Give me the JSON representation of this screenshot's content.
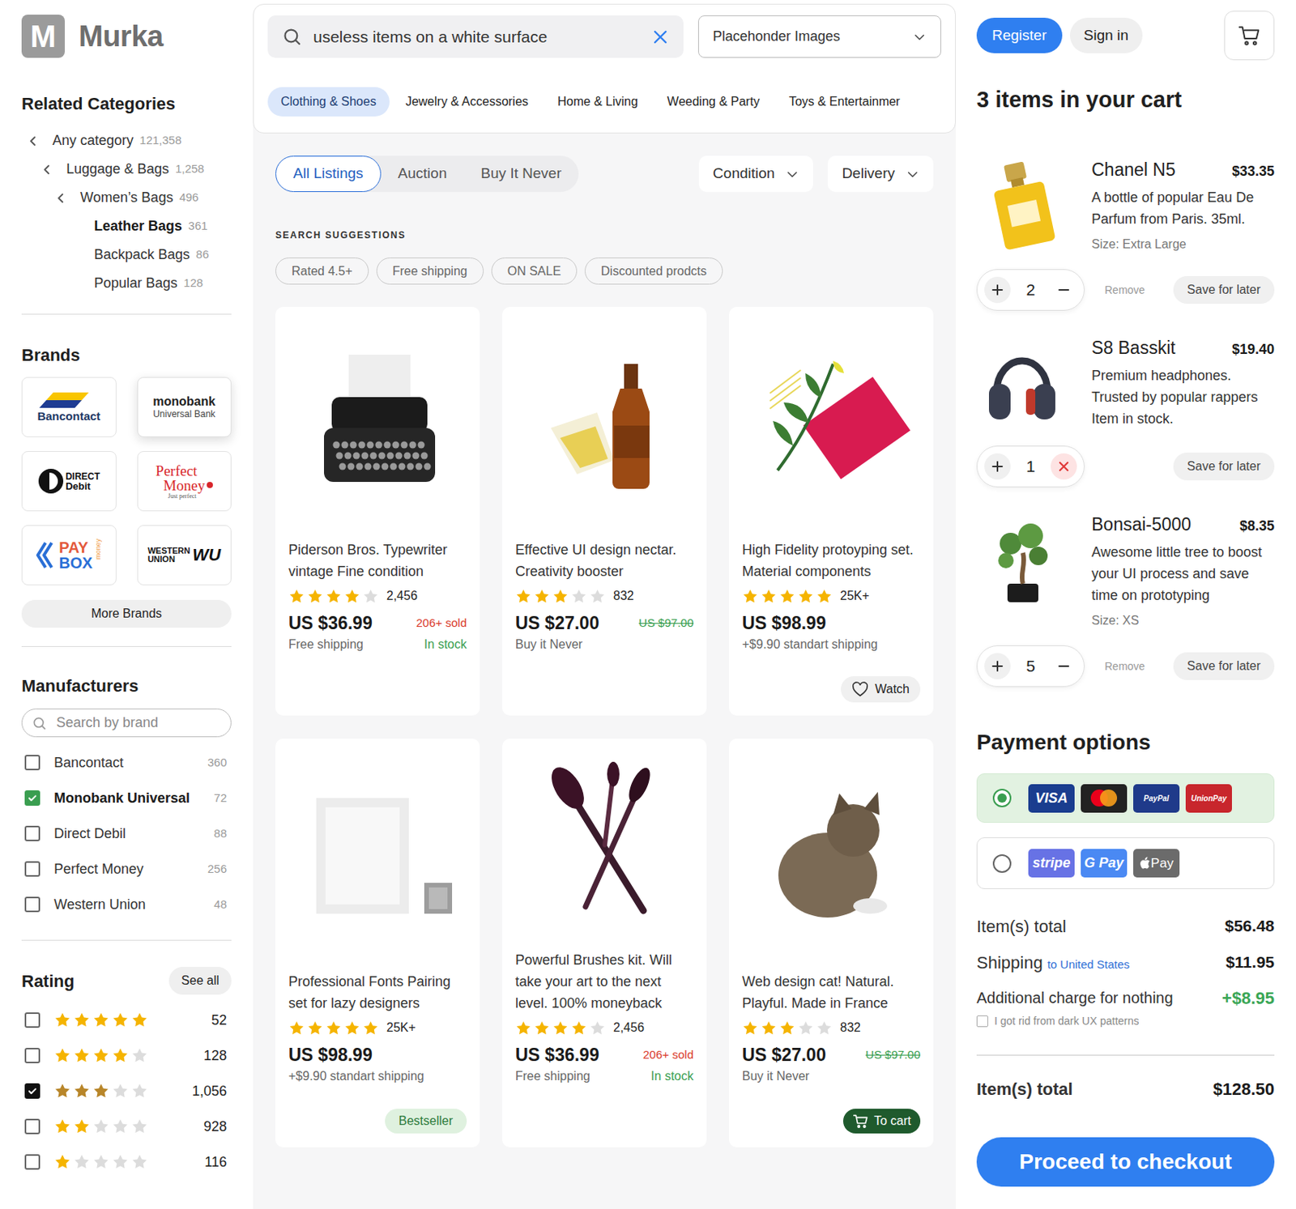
{
  "brand": {
    "mark": "M",
    "name": "Murka"
  },
  "search": {
    "value": "useless items on a white surface"
  },
  "image_source": {
    "label": "Placehonder Images"
  },
  "auth": {
    "register": "Register",
    "sign_in": "Sign in"
  },
  "category_tabs": [
    {
      "label": "Clothing & Shoes",
      "selected": true
    },
    {
      "label": "Jewelry & Accessories",
      "selected": false
    },
    {
      "label": "Home & Living",
      "selected": false
    },
    {
      "label": "Weeding & Party",
      "selected": false
    },
    {
      "label": "Toys & Entertainmer",
      "selected": false
    }
  ],
  "related": {
    "title": "Related Categories",
    "items": [
      {
        "label": "Any category",
        "count": "121,358",
        "depth": 0,
        "kind": "parent",
        "selected": false
      },
      {
        "label": "Luggage & Bags",
        "count": "1,258",
        "depth": 1,
        "kind": "parent",
        "selected": false
      },
      {
        "label": "Women’s Bags",
        "count": "496",
        "depth": 2,
        "kind": "parent",
        "selected": false
      },
      {
        "label": "Leather Bags",
        "count": "361",
        "depth": 3,
        "kind": "child",
        "selected": true
      },
      {
        "label": "Backpack Bags",
        "count": "86",
        "depth": 3,
        "kind": "child",
        "selected": false
      },
      {
        "label": "Popular Bags",
        "count": "128",
        "depth": 3,
        "kind": "child",
        "selected": false
      }
    ]
  },
  "brands": {
    "title": "Brands",
    "more": "More Brands",
    "tiles": [
      {
        "kind": "bancontact",
        "lines": [
          "Bancontact"
        ],
        "selected": false
      },
      {
        "kind": "stack",
        "lines": [
          "monobank",
          "Universal Bank"
        ],
        "selected": true
      },
      {
        "kind": "direct",
        "lines": [
          "DIRECT",
          "Debit"
        ],
        "selected": false
      },
      {
        "kind": "perfect",
        "lines": [
          "Perfect",
          "Money",
          "Just perfect"
        ],
        "selected": false
      },
      {
        "kind": "paybox",
        "lines": [
          "PAY",
          "BOX",
          "money"
        ],
        "selected": false
      },
      {
        "kind": "wu",
        "lines": [
          "WESTERN",
          "UNION",
          "WU"
        ],
        "selected": false
      }
    ]
  },
  "manufacturers": {
    "title": "Manufacturers",
    "placeholder": "Search by brand",
    "items": [
      {
        "label": "Bancontact",
        "count": "360",
        "checked": false
      },
      {
        "label": "Monobank Universal",
        "count": "72",
        "checked": true
      },
      {
        "label": "Direct Debil",
        "count": "88",
        "checked": false
      },
      {
        "label": "Perfect Money",
        "count": "256",
        "checked": false
      },
      {
        "label": "Western Union",
        "count": "48",
        "checked": false
      }
    ]
  },
  "rating": {
    "title": "Rating",
    "see_all": "See all",
    "rows": [
      {
        "stars": 5,
        "count": "52",
        "checked": false
      },
      {
        "stars": 4,
        "count": "128",
        "checked": false
      },
      {
        "stars": 3,
        "count": "1,056",
        "checked": true
      },
      {
        "stars": 2,
        "count": "928",
        "checked": false
      },
      {
        "stars": 1,
        "count": "116",
        "checked": false
      }
    ]
  },
  "listing_tabs": [
    {
      "label": "All Listings",
      "selected": true
    },
    {
      "label": "Auction",
      "selected": false
    },
    {
      "label": "Buy It Never",
      "selected": false
    }
  ],
  "filters": [
    {
      "label": "Condition"
    },
    {
      "label": "Delivery"
    }
  ],
  "suggestions": {
    "title": "SEARCH SUGGESTIONS",
    "chips": [
      "Rated 4.5+",
      "Free shipping",
      "ON SALE",
      "Discounted prodcts"
    ]
  },
  "products": [
    {
      "title": "Piderson Bros. Typewriter vintage Fine condition",
      "stars": 4,
      "reviews": "2,456",
      "price": "US $36.99",
      "tag": {
        "kind": "sold",
        "label": "206+ sold"
      },
      "shipping": "Free shipping",
      "stock": "In stock"
    },
    {
      "title": "Effective UI design nectar. Creativity booster",
      "stars": 3,
      "reviews": "832",
      "price": "US $27.00",
      "tag": {
        "kind": "old_price",
        "label": "US $97.00"
      },
      "shipping": "Buy it Never"
    },
    {
      "title": "High Fidelity protoyping set. Material components",
      "stars": 5,
      "reviews": "25K+",
      "price": "US $98.99",
      "shipping": "+$9.90 standart shipping",
      "action": {
        "kind": "watch",
        "label": "Watch"
      }
    },
    {
      "title": "Professional Fonts Pairing set for lazy designers",
      "stars": 5,
      "reviews": "25K+",
      "price": "US $98.99",
      "shipping": "+$9.90 standart shipping",
      "action": {
        "kind": "badge",
        "label": "Bestseller"
      }
    },
    {
      "title": "Powerful Brushes kit. Will take your art to the next level. 100% moneyback",
      "stars": 4,
      "reviews": "2,456",
      "price": "US $36.99",
      "tag": {
        "kind": "sold",
        "label": "206+ sold"
      },
      "shipping": "Free shipping",
      "stock": "In stock"
    },
    {
      "title": "Web design cat! Natural. Playful. Made in France",
      "stars": 3,
      "reviews": "832",
      "price": "US $27.00",
      "tag": {
        "kind": "old_price",
        "label": "US $97.00"
      },
      "shipping": "Buy it Never",
      "action": {
        "kind": "cart",
        "label": "To cart"
      }
    }
  ],
  "cart": {
    "title": "3 items in your cart",
    "items": [
      {
        "name": "Chanel N5",
        "price": "$33.35",
        "description": "A bottle of popular Eau De Parfum from Paris. 35ml.",
        "size": "Size: Extra Large",
        "quantity": "2",
        "remove_armed": false,
        "remove": "Remove",
        "save": "Save for later"
      },
      {
        "name": "S8 Basskit",
        "price": "$19.40",
        "description": "Premium headphones. Trusted by popular rappers Item in stock.",
        "quantity": "1",
        "remove_armed": true,
        "save": "Save for later"
      },
      {
        "name": "Bonsai-5000",
        "price": "$8.35",
        "description": "Awesome little tree to boost your UI process and save time on prototyping",
        "size": "Size: XS",
        "quantity": "5",
        "remove_armed": false,
        "remove": "Remove",
        "save": "Save for later"
      }
    ]
  },
  "payment": {
    "title": "Payment options",
    "options": [
      {
        "selected": true,
        "methods": [
          {
            "kind": "text",
            "label": "VISA",
            "color": "#1a3d8f"
          },
          {
            "kind": "mastercard",
            "color": "#222222"
          },
          {
            "kind": "small",
            "label": "PayPal",
            "color": "#1f3a8a"
          },
          {
            "kind": "small",
            "label": "UnionPay",
            "color": "#c8262c"
          }
        ]
      },
      {
        "selected": false,
        "methods": [
          {
            "kind": "text",
            "label": "stripe",
            "color": "#6772e5"
          },
          {
            "kind": "text",
            "label": "G Pay",
            "color": "#4a89f3"
          },
          {
            "kind": "apple",
            "label": "Pay",
            "color": "#6b6b6b"
          }
        ]
      }
    ]
  },
  "summary": {
    "rows": [
      {
        "label": "Item(s) total",
        "value": "$56.48",
        "kind": "plain"
      },
      {
        "label": "Shipping",
        "sub": "to United States",
        "value": "$11.95",
        "kind": "plain"
      },
      {
        "label": "Additional charge for nothing",
        "value": "+$8.95",
        "kind": "accent"
      }
    ],
    "opt_out": {
      "label": "I got rid from dark UX patterns",
      "checked": false
    },
    "total": {
      "label": "Item(s) total",
      "value": "$128.50"
    }
  },
  "checkout": "Proceed to checkout"
}
